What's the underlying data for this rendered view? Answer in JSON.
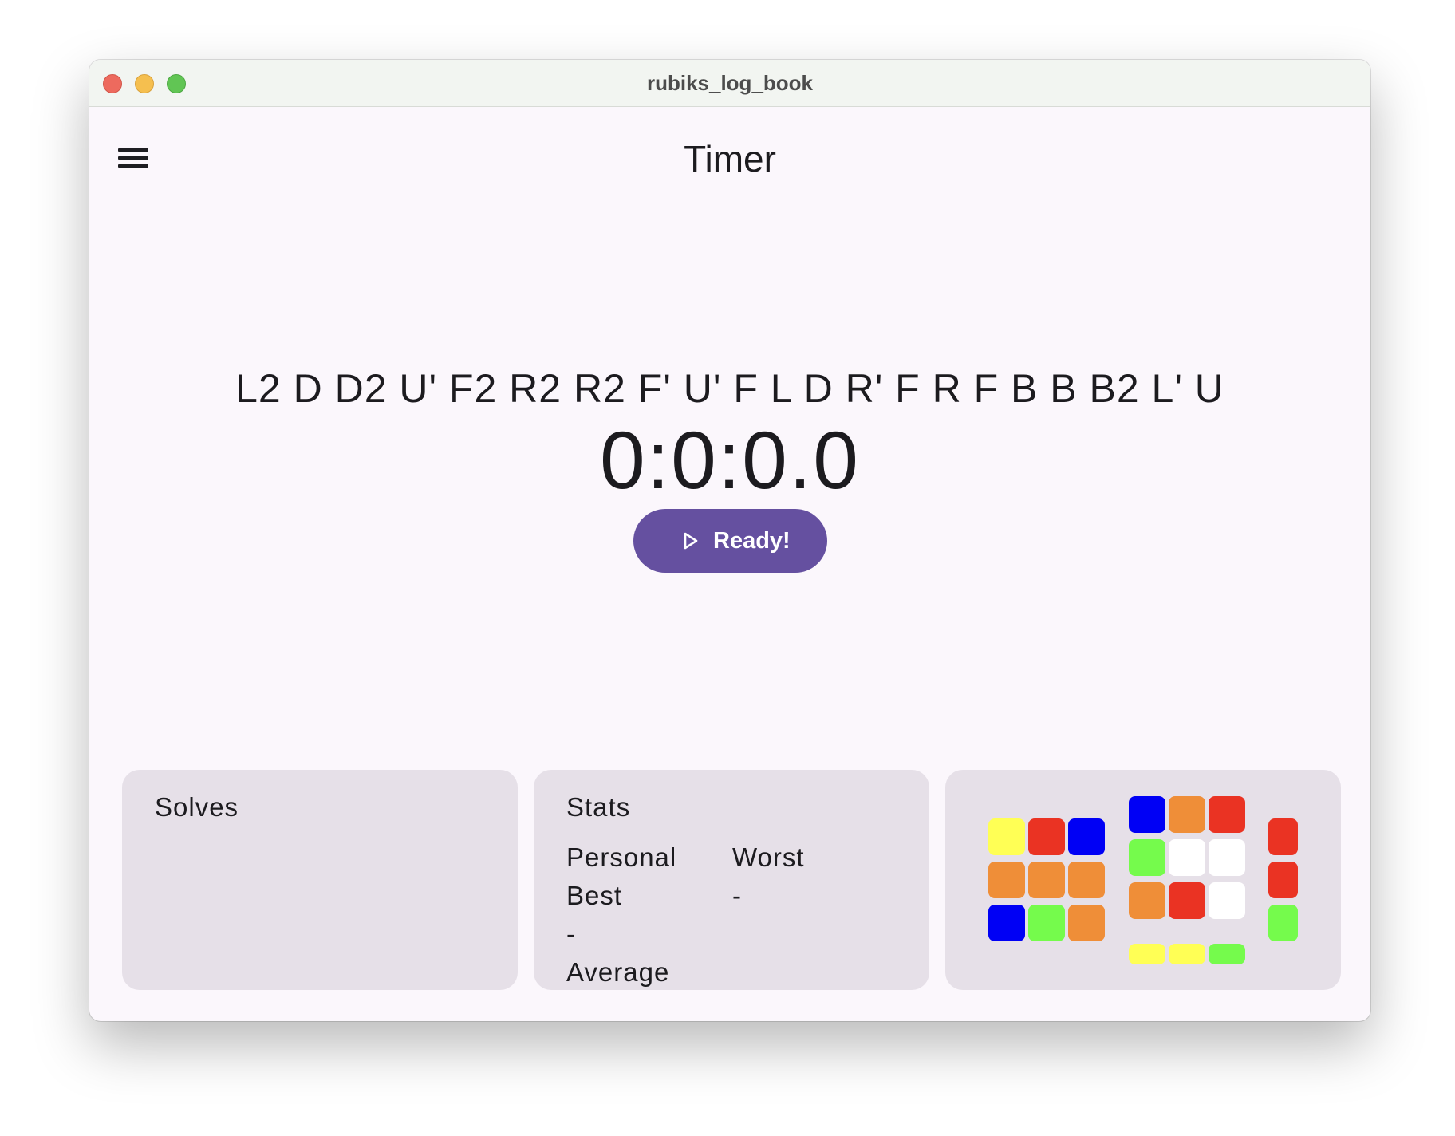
{
  "window": {
    "title": "rubiks_log_book"
  },
  "header": {
    "menu_icon": "hamburger-menu-icon",
    "title": "Timer"
  },
  "timer": {
    "scramble": "L2 D D2 U' F2 R2 R2 F' U' F L D R' F R F B B B2 L' U",
    "display": "0:0:0.0",
    "button_label": "Ready!",
    "button_icon": "play-outline-icon",
    "accent_color": "#6550a0"
  },
  "solves": {
    "title": "Solves"
  },
  "stats": {
    "title": "Stats",
    "personal_best_line1": "Personal",
    "personal_best_line2": "Best",
    "personal_best_value": "-",
    "average_label": "Average",
    "worst_label": "Worst",
    "worst_value": "-"
  },
  "cube_preview": {
    "colors": {
      "Y": "#ffff55",
      "R": "#ea3323",
      "B": "#0000f5",
      "O": "#ef8e38",
      "G": "#75fb4c",
      "W": "#ffffff"
    },
    "left_face": [
      [
        "Y",
        "R",
        "B"
      ],
      [
        "O",
        "O",
        "O"
      ],
      [
        "B",
        "G",
        "O"
      ]
    ],
    "front_face": [
      [
        "B",
        "O",
        "R"
      ],
      [
        "G",
        "W",
        "W"
      ],
      [
        "O",
        "R",
        "W"
      ]
    ],
    "right_column": [
      "R",
      "R",
      "G"
    ],
    "bottom_row": [
      "Y",
      "Y",
      "G"
    ]
  }
}
